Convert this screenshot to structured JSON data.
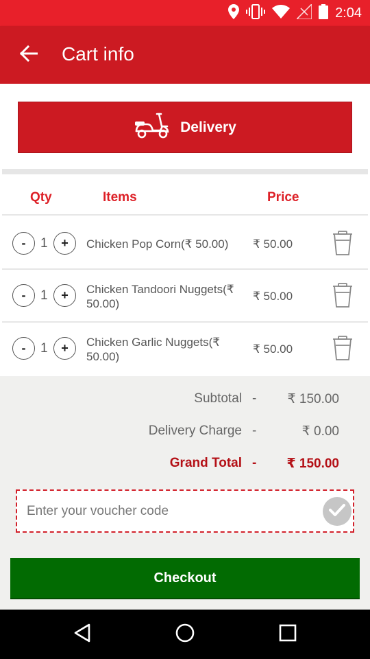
{
  "status_bar": {
    "time": "2:04",
    "icons": [
      "location-icon",
      "vibrate-icon",
      "wifi-icon",
      "signal-icon",
      "battery-icon"
    ]
  },
  "app_bar": {
    "title": "Cart info",
    "back_icon": "arrow-left-icon"
  },
  "delivery": {
    "label": "Delivery",
    "icon": "scooter-icon"
  },
  "table_header": {
    "qty": "Qty",
    "items": "Items",
    "price": "Price"
  },
  "items": [
    {
      "minus": "-",
      "qty": "1",
      "plus": "+",
      "name": "Chicken Pop Corn(₹ 50.00)",
      "price": "₹ 50.00"
    },
    {
      "minus": "-",
      "qty": "1",
      "plus": "+",
      "name": "Chicken Tandoori Nuggets(₹ 50.00)",
      "price": "₹ 50.00"
    },
    {
      "minus": "-",
      "qty": "1",
      "plus": "+",
      "name": "Chicken Garlic Nuggets(₹ 50.00)",
      "price": "₹ 50.00"
    }
  ],
  "totals": {
    "subtotal_label": "Subtotal",
    "subtotal_value": "₹ 150.00",
    "delivery_label": "Delivery Charge",
    "delivery_value": "₹ 0.00",
    "grand_label": "Grand Total",
    "grand_value": "₹ 150.00",
    "separator": "-"
  },
  "voucher": {
    "placeholder": "Enter your voucher code",
    "value": ""
  },
  "checkout": {
    "label": "Checkout"
  },
  "colors": {
    "status_bar": "#e8202a",
    "app_bar": "#cc1a22",
    "accent_red": "#dd2027",
    "grand_total": "#b41016",
    "checkout_green": "#026b02"
  }
}
